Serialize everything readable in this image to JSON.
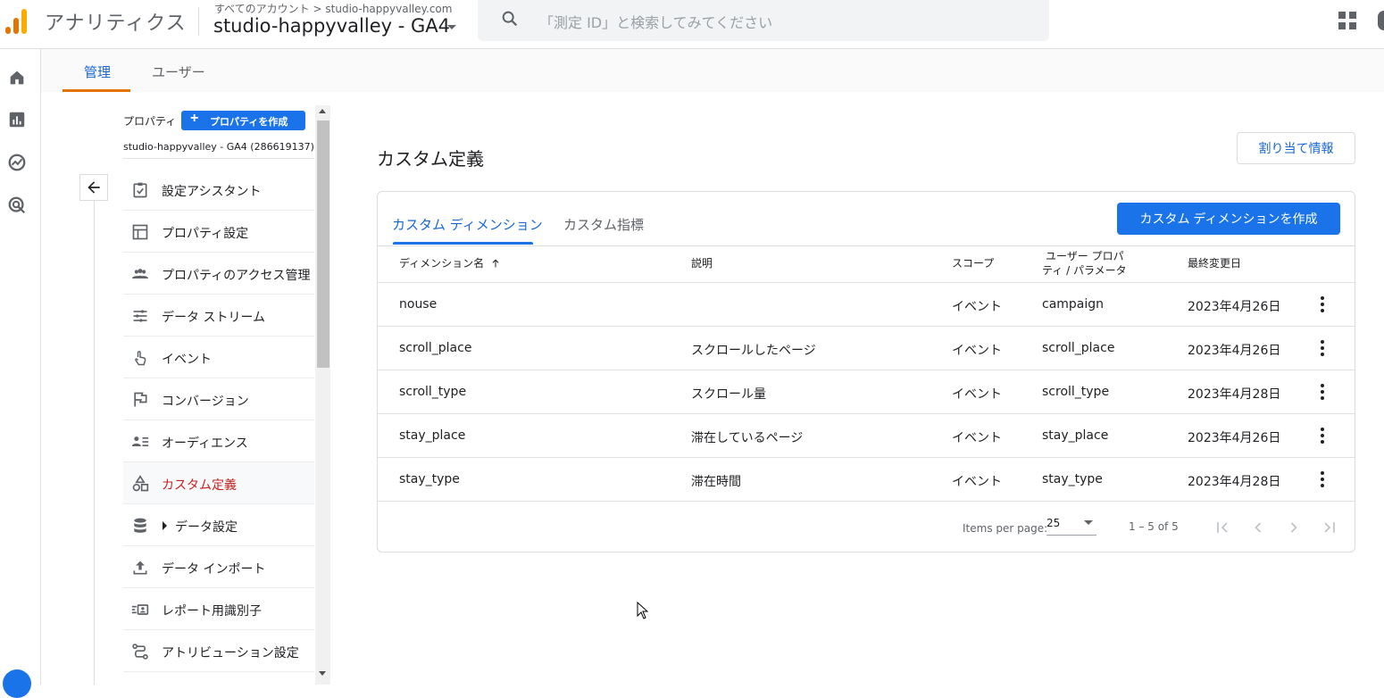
{
  "header": {
    "app_title": "アナリティクス",
    "breadcrumb_account": "すべてのアカウント",
    "breadcrumb_sep": ">",
    "breadcrumb_domain": "studio-happyvalley.com",
    "property_selector": "studio-happyvalley - GA4",
    "search_placeholder": "「測定 ID」と検索してみてください"
  },
  "admin_tabs": [
    {
      "label": "管理",
      "active": true
    },
    {
      "label": "ユーザー",
      "active": false
    }
  ],
  "sidenav": {
    "property_label": "プロパティ",
    "create_property_label": "プロパティを作成",
    "property_full_name": "studio-happyvalley - GA4 (286619137)",
    "items": [
      {
        "label": "設定アシスタント",
        "icon": "checklist-icon"
      },
      {
        "label": "プロパティ設定",
        "icon": "property-settings-icon"
      },
      {
        "label": "プロパティのアクセス管理",
        "icon": "people-icon"
      },
      {
        "label": "データ ストリーム",
        "icon": "data-stream-icon"
      },
      {
        "label": "イベント",
        "icon": "touch-icon"
      },
      {
        "label": "コンバージョン",
        "icon": "flag-icon"
      },
      {
        "label": "オーディエンス",
        "icon": "audience-icon"
      },
      {
        "label": "カスタム定義",
        "icon": "shapes-icon",
        "active": true
      },
      {
        "label": "データ設定",
        "icon": "database-icon",
        "expandable": true
      },
      {
        "label": "データ インポート",
        "icon": "upload-icon"
      },
      {
        "label": "レポート用識別子",
        "icon": "identity-icon"
      },
      {
        "label": "アトリビューション設定",
        "icon": "attribution-icon"
      }
    ]
  },
  "main": {
    "title": "カスタム定義",
    "assign_button": "割り当て情報",
    "tabs": [
      {
        "label": "カスタム ディメンション",
        "active": true
      },
      {
        "label": "カスタム指標",
        "active": false
      }
    ],
    "create_button": "カスタム ディメンションを作成",
    "columns": {
      "name": "ディメンション名",
      "description": "説明",
      "scope": "スコープ",
      "param_line1": "ユーザー プロパ",
      "param_line2": "ティ / パラメータ",
      "modified": "最終変更日"
    },
    "rows": [
      {
        "name": "nouse",
        "description": "",
        "scope": "イベント",
        "param": "campaign",
        "modified": "2023年4月26日"
      },
      {
        "name": "scroll_place",
        "description": "スクロールしたページ",
        "scope": "イベント",
        "param": "scroll_place",
        "modified": "2023年4月26日"
      },
      {
        "name": "scroll_type",
        "description": "スクロール量",
        "scope": "イベント",
        "param": "scroll_type",
        "modified": "2023年4月28日"
      },
      {
        "name": "stay_place",
        "description": "滞在しているページ",
        "scope": "イベント",
        "param": "stay_place",
        "modified": "2023年4月26日"
      },
      {
        "name": "stay_type",
        "description": "滞在時間",
        "scope": "イベント",
        "param": "stay_type",
        "modified": "2023年4月28日"
      }
    ],
    "pager": {
      "items_per_page_label": "Items per page:",
      "items_per_page_value": "25",
      "range": "1 – 5 of 5"
    }
  },
  "colors": {
    "accent_blue": "#1a73e8",
    "active_red": "#c5221f",
    "tab_orange": "#e37400"
  }
}
